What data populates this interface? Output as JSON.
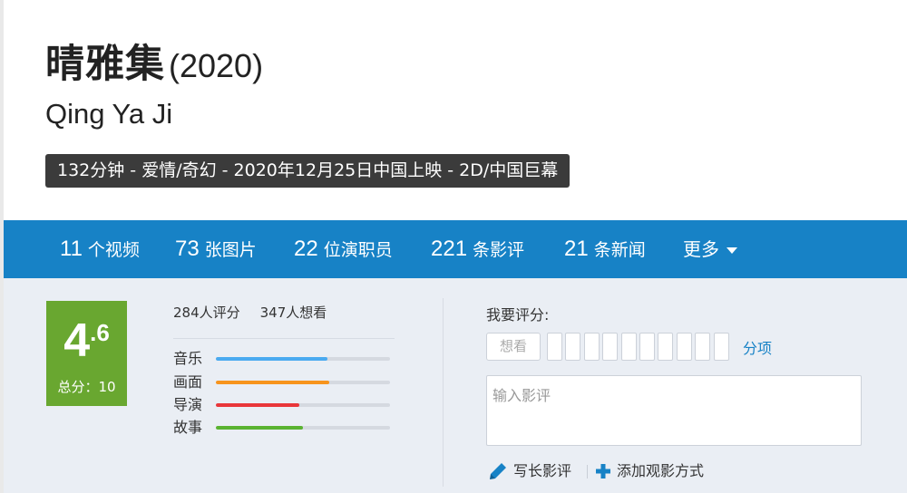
{
  "movie": {
    "title_cn": "晴雅集",
    "year": "(2020)",
    "title_en": "Qing Ya Ji",
    "info": "132分钟 - 爱情/奇幻 - 2020年12月25日中国上映 - 2D/中国巨幕"
  },
  "nav": {
    "items": [
      {
        "num": "11",
        "label": "个视频"
      },
      {
        "num": "73",
        "label": "张图片"
      },
      {
        "num": "22",
        "label": "位演职员"
      },
      {
        "num": "221",
        "label": "条影评"
      },
      {
        "num": "21",
        "label": "条新闻"
      }
    ],
    "more": "更多"
  },
  "score": {
    "integer": "4",
    "decimal": ".6",
    "total": "总分：10"
  },
  "stats": {
    "raters": "284人评分",
    "wanters": "347人想看"
  },
  "sub_ratings": [
    {
      "label": "音乐",
      "fraction": 0.64,
      "color": "#4aaaf0"
    },
    {
      "label": "画面",
      "fraction": 0.65,
      "color": "#f7941d"
    },
    {
      "label": "导演",
      "fraction": 0.48,
      "color": "#e9363a"
    },
    {
      "label": "故事",
      "fraction": 0.5,
      "color": "#5ab331"
    }
  ],
  "my_rating": {
    "label": "我要评分:",
    "want_button": "想看",
    "star_count": 10,
    "detail_link": "分项",
    "review_placeholder": "输入影评"
  },
  "actions": {
    "write_review": "写长影评",
    "add_watch": "添加观影方式"
  },
  "colors": {
    "nav_bg": "#1782c6",
    "score_bg": "#69a730",
    "badge_bg": "#3b3b3b",
    "link": "#1782c6"
  }
}
